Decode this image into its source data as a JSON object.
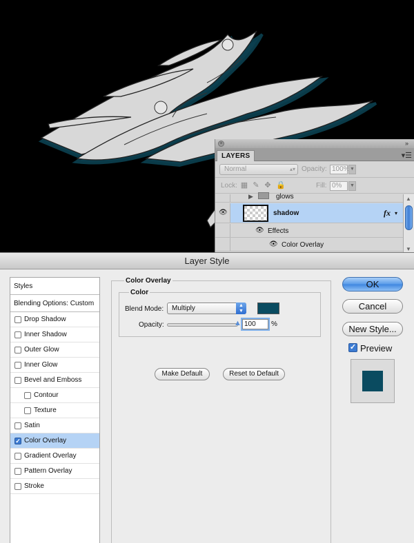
{
  "colors": {
    "overlay": "#0a4b60",
    "selected_row": "#b5d3f5",
    "accent": "#3c7bd2"
  },
  "layers_panel": {
    "tab": "LAYERS",
    "blend_mode": "Normal",
    "opacity_label": "Opacity:",
    "opacity_value": "100%",
    "lock_label": "Lock:",
    "fill_label": "Fill:",
    "fill_value": "0%",
    "rows": [
      {
        "name": "glows"
      },
      {
        "name": "shadow",
        "fx": "fx"
      },
      {
        "name": "Effects"
      },
      {
        "name": "Color Overlay"
      }
    ]
  },
  "dialog": {
    "title": "Layer Style",
    "styles_header": "Styles",
    "blending_options": "Blending Options: Custom",
    "style_items": [
      {
        "label": "Drop Shadow",
        "checked": false
      },
      {
        "label": "Inner Shadow",
        "checked": false
      },
      {
        "label": "Outer Glow",
        "checked": false
      },
      {
        "label": "Inner Glow",
        "checked": false
      },
      {
        "label": "Bevel and Emboss",
        "checked": false
      },
      {
        "label": "Contour",
        "checked": false
      },
      {
        "label": "Texture",
        "checked": false
      },
      {
        "label": "Satin",
        "checked": false
      },
      {
        "label": "Color Overlay",
        "checked": true
      },
      {
        "label": "Gradient Overlay",
        "checked": false
      },
      {
        "label": "Pattern Overlay",
        "checked": false
      },
      {
        "label": "Stroke",
        "checked": false
      }
    ],
    "section_title": "Color Overlay",
    "group_title": "Color",
    "blend_mode_label": "Blend Mode:",
    "blend_mode_value": "Multiply",
    "opacity_label": "Opacity:",
    "opacity_value": "100",
    "opacity_unit": "%",
    "make_default": "Make Default",
    "reset_default": "Reset to Default",
    "ok": "OK",
    "cancel": "Cancel",
    "new_style": "New Style...",
    "preview_label": "Preview",
    "preview_checked": true
  }
}
